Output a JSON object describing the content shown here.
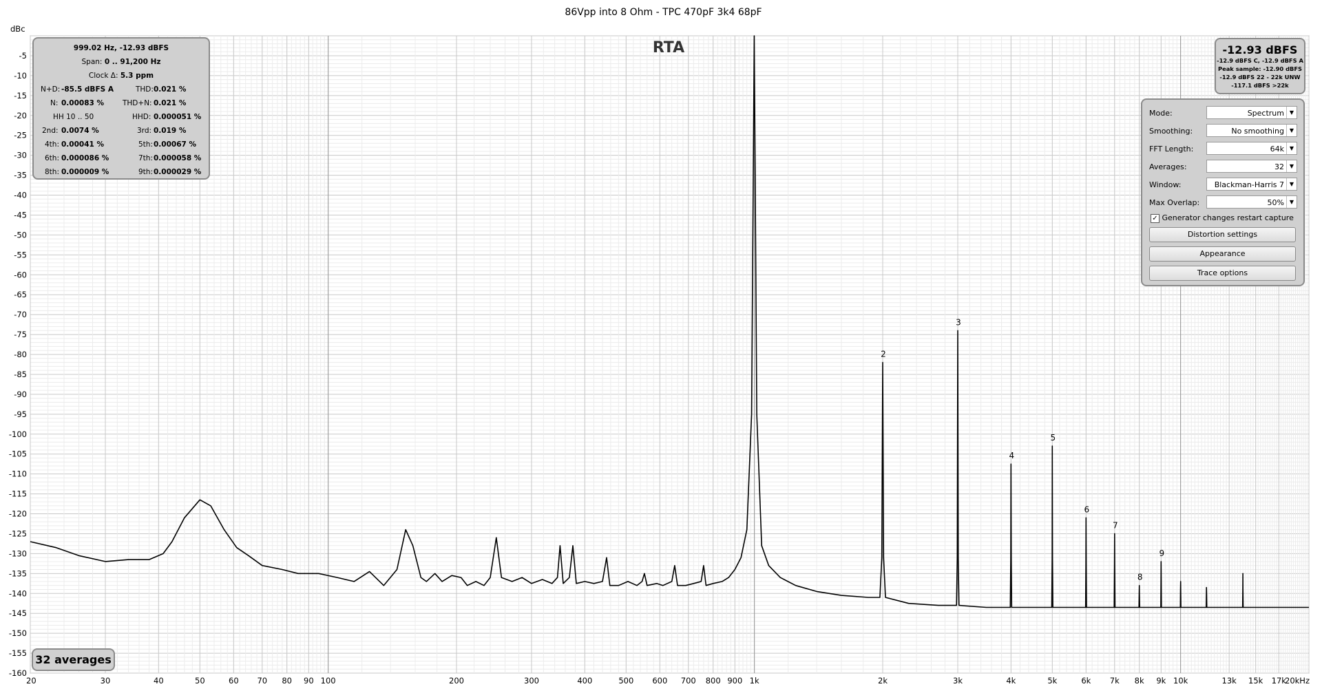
{
  "chart_data": {
    "type": "line",
    "title": "86Vpp into 8 Ohm - TPC 470pF 3k4 68pF",
    "ylabel": "dBc",
    "overlay_label": "RTA",
    "x_scale": "log",
    "xlim": [
      20,
      20000
    ],
    "ylim": [
      -160,
      0
    ],
    "y_ticks": [
      -5,
      -10,
      -15,
      -20,
      -25,
      -30,
      -35,
      -40,
      -45,
      -50,
      -55,
      -60,
      -65,
      -70,
      -75,
      -80,
      -85,
      -90,
      -95,
      -100,
      -105,
      -110,
      -115,
      -120,
      -125,
      -130,
      -135,
      -140,
      -145,
      -150,
      -155,
      -160
    ],
    "x_ticks": [
      {
        "v": 20,
        "label": "20"
      },
      {
        "v": 30,
        "label": "30"
      },
      {
        "v": 40,
        "label": "40"
      },
      {
        "v": 50,
        "label": "50"
      },
      {
        "v": 60,
        "label": "60"
      },
      {
        "v": 70,
        "label": "70"
      },
      {
        "v": 80,
        "label": "80"
      },
      {
        "v": 90,
        "label": "90"
      },
      {
        "v": 100,
        "label": "100"
      },
      {
        "v": 200,
        "label": "200"
      },
      {
        "v": 300,
        "label": "300"
      },
      {
        "v": 400,
        "label": "400"
      },
      {
        "v": 500,
        "label": "500"
      },
      {
        "v": 600,
        "label": "600"
      },
      {
        "v": 700,
        "label": "700"
      },
      {
        "v": 800,
        "label": "800"
      },
      {
        "v": 900,
        "label": "900"
      },
      {
        "v": 1000,
        "label": "1k"
      },
      {
        "v": 2000,
        "label": "2k"
      },
      {
        "v": 3000,
        "label": "3k"
      },
      {
        "v": 4000,
        "label": "4k"
      },
      {
        "v": 5000,
        "label": "5k"
      },
      {
        "v": 6000,
        "label": "6k"
      },
      {
        "v": 7000,
        "label": "7k"
      },
      {
        "v": 8000,
        "label": "8k"
      },
      {
        "v": 9000,
        "label": "9k"
      },
      {
        "v": 10000,
        "label": "10k"
      },
      {
        "v": 13000,
        "label": "13k"
      },
      {
        "v": 15000,
        "label": "15k"
      },
      {
        "v": 17000,
        "label": "17k"
      },
      {
        "v": 20000,
        "label": "20kHz"
      }
    ],
    "grid": true,
    "series": [
      {
        "color": "#000000",
        "points": [
          [
            20,
            -127
          ],
          [
            23,
            -128.5
          ],
          [
            26,
            -130.5
          ],
          [
            30,
            -132
          ],
          [
            34,
            -131.5
          ],
          [
            38,
            -131.5
          ],
          [
            41,
            -130
          ],
          [
            43,
            -127
          ],
          [
            46,
            -121
          ],
          [
            50,
            -116.5
          ],
          [
            53,
            -118
          ],
          [
            57,
            -124
          ],
          [
            61,
            -128.5
          ],
          [
            65,
            -130.5
          ],
          [
            70,
            -133
          ],
          [
            78,
            -134
          ],
          [
            85,
            -135
          ],
          [
            95,
            -135
          ],
          [
            105,
            -136
          ],
          [
            115,
            -137
          ],
          [
            125,
            -134.5
          ],
          [
            135,
            -138
          ],
          [
            145,
            -134
          ],
          [
            152,
            -124
          ],
          [
            158,
            -128
          ],
          [
            165,
            -136
          ],
          [
            170,
            -137
          ],
          [
            178,
            -135
          ],
          [
            185,
            -137
          ],
          [
            195,
            -135.5
          ],
          [
            205,
            -136
          ],
          [
            212,
            -138
          ],
          [
            222,
            -137
          ],
          [
            232,
            -138
          ],
          [
            240,
            -136
          ],
          [
            248,
            -126
          ],
          [
            255,
            -136
          ],
          [
            270,
            -137
          ],
          [
            285,
            -136
          ],
          [
            300,
            -137.5
          ],
          [
            318,
            -136.5
          ],
          [
            335,
            -137.5
          ],
          [
            345,
            -136
          ],
          [
            350,
            -128
          ],
          [
            356,
            -137.5
          ],
          [
            368,
            -136
          ],
          [
            375,
            -128
          ],
          [
            382,
            -137.5
          ],
          [
            400,
            -137
          ],
          [
            420,
            -137.5
          ],
          [
            440,
            -137
          ],
          [
            450,
            -131
          ],
          [
            458,
            -138
          ],
          [
            480,
            -138
          ],
          [
            505,
            -137
          ],
          [
            530,
            -138
          ],
          [
            545,
            -137
          ],
          [
            552,
            -135
          ],
          [
            560,
            -138
          ],
          [
            590,
            -137.5
          ],
          [
            610,
            -138
          ],
          [
            640,
            -137
          ],
          [
            650,
            -133
          ],
          [
            660,
            -138
          ],
          [
            690,
            -138
          ],
          [
            720,
            -137.5
          ],
          [
            750,
            -137
          ],
          [
            760,
            -133
          ],
          [
            770,
            -138
          ],
          [
            800,
            -137.5
          ],
          [
            840,
            -137
          ],
          [
            870,
            -136
          ],
          [
            900,
            -134
          ],
          [
            930,
            -131
          ],
          [
            960,
            -124
          ],
          [
            985,
            -95
          ],
          [
            993,
            -40
          ],
          [
            999,
            0
          ],
          [
            1005,
            -40
          ],
          [
            1013,
            -95
          ],
          [
            1040,
            -128
          ],
          [
            1080,
            -133
          ],
          [
            1150,
            -136
          ],
          [
            1250,
            -138
          ],
          [
            1400,
            -139.5
          ],
          [
            1600,
            -140.5
          ],
          [
            1850,
            -141
          ],
          [
            1970,
            -141
          ],
          [
            1990,
            -131
          ],
          [
            2000,
            -82
          ],
          [
            2010,
            -131
          ],
          [
            2030,
            -141
          ],
          [
            2300,
            -142.5
          ],
          [
            2700,
            -143
          ],
          [
            2980,
            -143
          ],
          [
            2992,
            -131
          ],
          [
            3000,
            -74
          ],
          [
            3008,
            -131
          ],
          [
            3020,
            -143
          ],
          [
            3500,
            -143.5
          ],
          [
            3985,
            -143.5
          ],
          [
            3995,
            -131
          ],
          [
            4000,
            -107.5
          ],
          [
            4005,
            -131
          ],
          [
            4015,
            -143.5
          ],
          [
            4500,
            -143.5
          ],
          [
            4985,
            -143.5
          ],
          [
            4995,
            -131
          ],
          [
            5000,
            -103
          ],
          [
            5005,
            -131
          ],
          [
            5015,
            -143.5
          ],
          [
            5500,
            -143.5
          ],
          [
            5985,
            -143.5
          ],
          [
            5995,
            -133
          ],
          [
            6000,
            -121
          ],
          [
            6005,
            -133
          ],
          [
            6015,
            -143.5
          ],
          [
            6500,
            -143.5
          ],
          [
            6985,
            -143.5
          ],
          [
            6995,
            -133
          ],
          [
            7000,
            -125
          ],
          [
            7005,
            -133
          ],
          [
            7015,
            -143.5
          ],
          [
            7500,
            -143.5
          ],
          [
            7985,
            -143.5
          ],
          [
            7995,
            -140
          ],
          [
            8000,
            -138
          ],
          [
            8005,
            -140
          ],
          [
            8015,
            -143.5
          ],
          [
            8500,
            -143.5
          ],
          [
            8985,
            -143.5
          ],
          [
            8995,
            -136
          ],
          [
            9000,
            -132
          ],
          [
            9005,
            -136
          ],
          [
            9015,
            -143.5
          ],
          [
            9500,
            -143.5
          ],
          [
            9985,
            -143.5
          ],
          [
            9995,
            -139
          ],
          [
            10000,
            -137
          ],
          [
            10005,
            -139
          ],
          [
            10015,
            -143.5
          ],
          [
            11000,
            -143.5
          ],
          [
            11480,
            -143.5
          ],
          [
            11495,
            -140
          ],
          [
            11500,
            -138.5
          ],
          [
            11505,
            -140
          ],
          [
            11520,
            -143.5
          ],
          [
            13500,
            -143.5
          ],
          [
            13980,
            -143.5
          ],
          [
            13995,
            -139
          ],
          [
            14000,
            -135
          ],
          [
            14005,
            -139
          ],
          [
            14020,
            -143.5
          ],
          [
            16000,
            -143.5
          ],
          [
            18000,
            -143.5
          ],
          [
            20000,
            -143.5
          ]
        ]
      }
    ],
    "annotations": [
      {
        "label": "2",
        "x": 2000,
        "y": -82
      },
      {
        "label": "3",
        "x": 3000,
        "y": -74
      },
      {
        "label": "4",
        "x": 4000,
        "y": -107.5
      },
      {
        "label": "5",
        "x": 5000,
        "y": -103
      },
      {
        "label": "6",
        "x": 6000,
        "y": -121
      },
      {
        "label": "7",
        "x": 7000,
        "y": -125
      },
      {
        "label": "8",
        "x": 8000,
        "y": -138
      },
      {
        "label": "9",
        "x": 9000,
        "y": -132
      }
    ]
  },
  "info_box": {
    "header": "999.02 Hz, -12.93 dBFS",
    "span_label": "Span:",
    "span_value": "0 .. 91,200 Hz",
    "clock_label": "Clock Δ:",
    "clock_value": "5.3 ppm",
    "nd_label": "N+D:",
    "nd_value": "-85.5 dBFS A",
    "thd_label": "THD:",
    "thd_value": "0.021 %",
    "n_label": "N:",
    "n_value": "0.00083 %",
    "thdn_label": "THD+N:",
    "thdn_value": "0.021 %",
    "hh_label": "HH 10 .. 50",
    "hhd_label": "HHD:",
    "hhd_value": "0.000051 %",
    "h2_label": "2nd:",
    "h2_value": "0.0074 %",
    "h3_label": "3rd:",
    "h3_value": "0.019 %",
    "h4_label": "4th:",
    "h4_value": "0.00041 %",
    "h5_label": "5th:",
    "h5_value": "0.00067 %",
    "h6_label": "6th:",
    "h6_value": "0.000086 %",
    "h7_label": "7th:",
    "h7_value": "0.000058 %",
    "h8_label": "8th:",
    "h8_value": "0.000009 %",
    "h9_label": "9th:",
    "h9_value": "0.000029 %"
  },
  "level_box": {
    "main": "-12.93 dBFS",
    "line1": "-12.9 dBFS C, -12.9 dBFS A",
    "line2": "Peak sample: -12.90 dBFS",
    "line3": "-12.9 dBFS 22 - 22k UNW",
    "line4": "-117.1 dBFS >22k"
  },
  "controls": {
    "mode_label": "Mode:",
    "mode_value": "Spectrum",
    "smoothing_label": "Smoothing:",
    "smoothing_value": "No  smoothing",
    "fft_label": "FFT Length:",
    "fft_value": "64k",
    "averages_label": "Averages:",
    "averages_value": "32",
    "window_label": "Window:",
    "window_value": "Blackman-Harris 7",
    "overlap_label": "Max Overlap:",
    "overlap_value": "50%",
    "restart_label": "Generator changes restart capture",
    "restart_checked": true,
    "distortion_btn": "Distortion settings",
    "appearance_btn": "Appearance",
    "trace_btn": "Trace options"
  },
  "averages_badge": "32 averages"
}
